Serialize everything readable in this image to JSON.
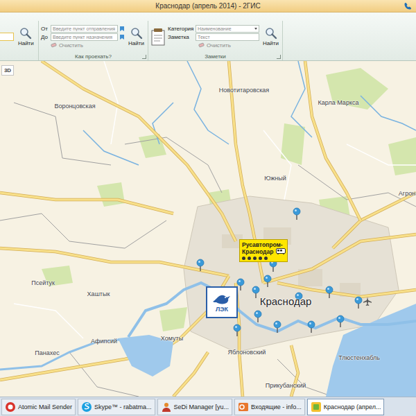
{
  "window": {
    "title": "Краснодар (апрель 2014) - 2ГИС"
  },
  "ribbon": {
    "search": {
      "find": "Найти"
    },
    "route": {
      "from_label": "От",
      "from_placeholder": "Введите пункт отправления",
      "to_label": "До",
      "to_placeholder": "Введите пункт назначения",
      "find": "Найти",
      "clear": "Очистить",
      "group": "Как проехать?"
    },
    "notes": {
      "category_label": "Категория",
      "category_value": "Наименование",
      "note_label": "Заметка",
      "note_placeholder": "Текст",
      "find": "Найти",
      "clear": "Очистить",
      "group": "Заметки"
    }
  },
  "map": {
    "view_button": "3D",
    "labels": [
      {
        "text": "Новотитаровская",
        "kind": "settlement"
      },
      {
        "text": "Воронцовская",
        "kind": "settlement"
      },
      {
        "text": "Карла Маркса",
        "kind": "settlement"
      },
      {
        "text": "Южный",
        "kind": "settlement"
      },
      {
        "text": "Агрон",
        "kind": "settlement"
      },
      {
        "text": "Псейтук",
        "kind": "settlement"
      },
      {
        "text": "Хаштык",
        "kind": "settlement"
      },
      {
        "text": "Краснодар",
        "kind": "city"
      },
      {
        "text": "Хомуты",
        "kind": "settlement"
      },
      {
        "text": "Афипсий",
        "kind": "settlement"
      },
      {
        "text": "Панахес",
        "kind": "settlement"
      },
      {
        "text": "Яблоновский",
        "kind": "settlement"
      },
      {
        "text": "Тлюстенхабль",
        "kind": "settlement"
      },
      {
        "text": "Прикубанский",
        "kind": "settlement"
      }
    ],
    "ads": {
      "rusavtoprom": "Русавтопром-Краснодар",
      "lek": "ЛЭК"
    }
  },
  "taskbar": {
    "items": [
      {
        "label": "Atomic Mail Sender",
        "selected": false
      },
      {
        "label": "Skype™ - rabatma...",
        "selected": false
      },
      {
        "label": "SeDi Manager [yu...",
        "selected": false
      },
      {
        "label": "Входящие - info...",
        "selected": false
      },
      {
        "label": "Краснодар (апрел...",
        "selected": true
      }
    ]
  }
}
